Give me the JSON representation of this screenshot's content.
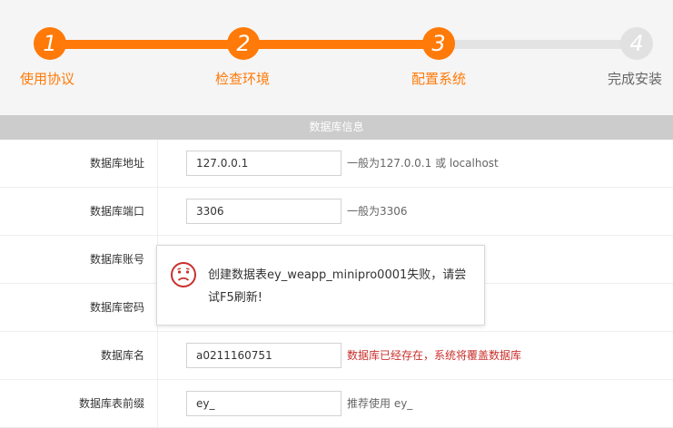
{
  "steps": [
    {
      "number": "1",
      "label": "使用协议",
      "state": "done"
    },
    {
      "number": "2",
      "label": "检查环境",
      "state": "done"
    },
    {
      "number": "3",
      "label": "配置系统",
      "state": "current"
    },
    {
      "number": "4",
      "label": "完成安装",
      "state": "pending"
    }
  ],
  "colors": {
    "accent": "#ff7a08",
    "inactive": "#e1e1e1",
    "warning": "#c9302c"
  },
  "section": {
    "title": "数据库信息"
  },
  "form": {
    "db_host": {
      "label": "数据库地址",
      "value": "127.0.0.1",
      "hint": "一般为127.0.0.1 或 localhost"
    },
    "db_port": {
      "label": "数据库端口",
      "value": "3306",
      "hint": "一般为3306"
    },
    "db_user": {
      "label": "数据库账号"
    },
    "db_password": {
      "label": "数据库密码"
    },
    "db_name": {
      "label": "数据库名",
      "value": "a0211160751",
      "hint": "数据库已经存在，系统将覆盖数据库"
    },
    "db_prefix": {
      "label": "数据库表前缀",
      "value": "ey_",
      "hint": "推荐使用 ey_"
    }
  },
  "toast": {
    "icon": "sad-face-icon",
    "message": "创建数据表ey_weapp_minipro0001失败，请尝试F5刷新!"
  }
}
